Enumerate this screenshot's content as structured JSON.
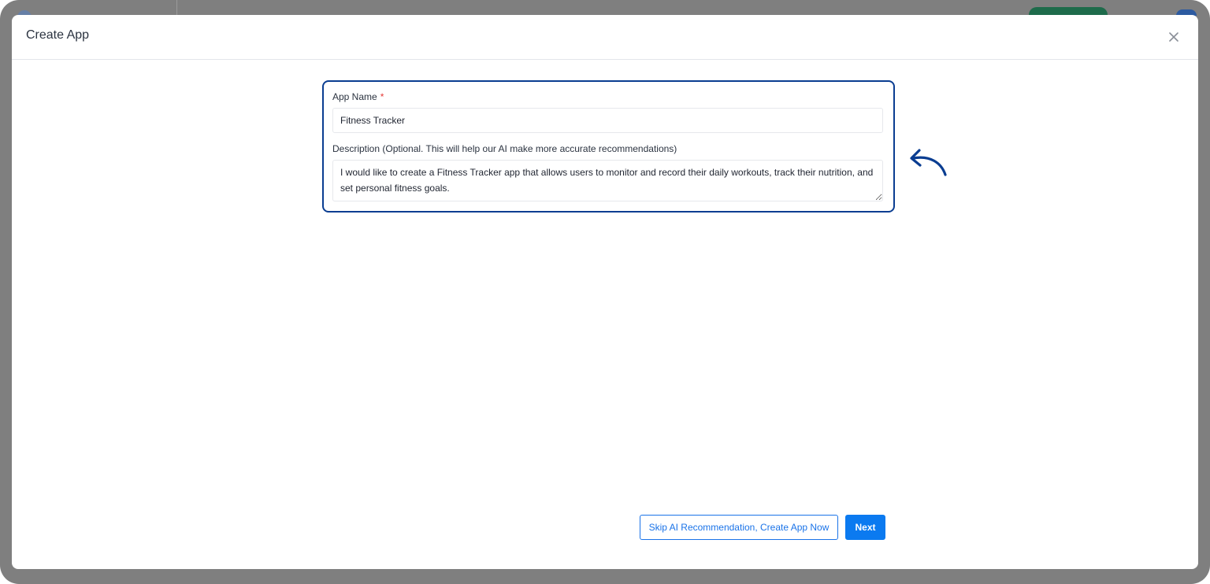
{
  "modal": {
    "title": "Create App",
    "close_icon": "close-icon"
  },
  "form": {
    "app_name": {
      "label": "App Name",
      "required_marker": "*",
      "value": "Fitness Tracker"
    },
    "description": {
      "label": "Description (Optional. This will help our AI make more accurate recommendations)",
      "value": "I would like to create a Fitness Tracker app that allows users to monitor and record their daily workouts, track their nutrition, and set personal fitness goals."
    }
  },
  "annotation": {
    "icon": "curved-arrow-icon",
    "color": "#0a3d91"
  },
  "footer": {
    "skip_label": "Skip AI Recommendation, Create App Now",
    "next_label": "Next"
  },
  "colors": {
    "accent": "#0b7af0",
    "highlight_border": "#0a3d91",
    "required": "#e53935"
  }
}
